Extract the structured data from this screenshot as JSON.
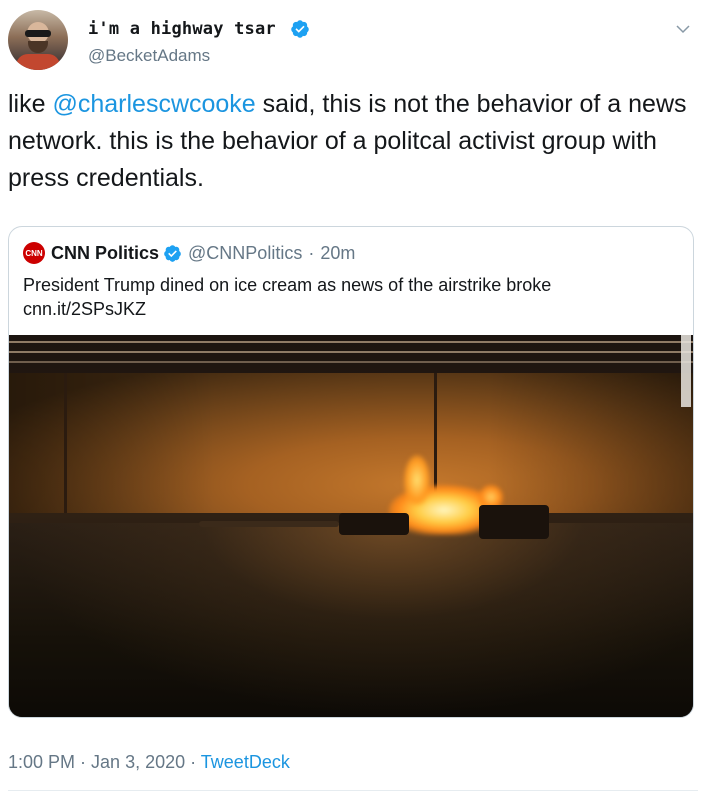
{
  "author": {
    "display_name": "i'm a highway tsar",
    "handle": "@BecketAdams"
  },
  "tweet": {
    "text_before": "like ",
    "mention": "@charlescwcooke",
    "text_after": " said, this is not the behavior of a news network. this is the behavior of a politcal activist group with press credentials."
  },
  "quoted_tweet": {
    "logo_text": "CNN",
    "name": "CNN Politics",
    "handle": "@CNNPolitics",
    "separator": "·",
    "time": "20m",
    "text_line1": "President Trump dined on ice cream as news of the airstrike broke",
    "text_line2": "cnn.it/2SPsJKZ"
  },
  "footer": {
    "time": "1:00 PM",
    "separator1": " · ",
    "date": "Jan 3, 2020",
    "separator2": " · ",
    "source": "TweetDeck"
  },
  "colors": {
    "link": "#1b95e0",
    "verified": "#1da1f2",
    "secondary_text": "#657786",
    "cnn_red": "#cc0000"
  },
  "icons": [
    "verified-badge-icon",
    "chevron-down-icon",
    "cnn-logo-icon"
  ]
}
